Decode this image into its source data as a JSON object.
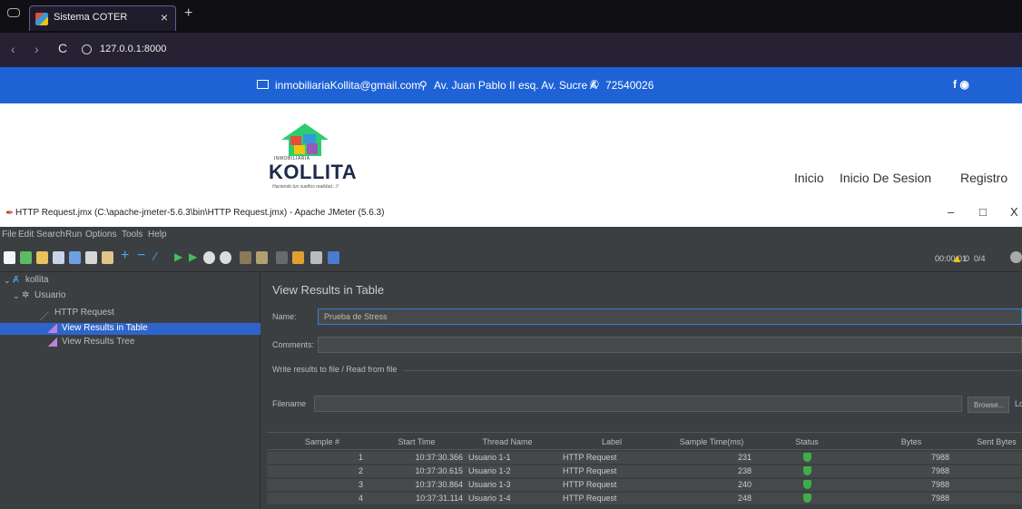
{
  "browser": {
    "tab_title": "Sistema COTER",
    "tab_close": "×",
    "new_tab": "+",
    "url": "127.0.0.1:8000",
    "back": "‹",
    "forward": "›",
    "reload": "C"
  },
  "site": {
    "email": "inmobiliariaKollita@gmail.com",
    "address": "Av. Juan Pablo II esq. Av. Sucre A",
    "phone": "72540026",
    "social": "f  ◉",
    "logo_small": "INMOBILIARIA",
    "logo_brand": "KOLLITA",
    "logo_slogan": "Haciendo tus sueños realidad...!!",
    "nav": [
      "Inicio",
      "Inicio De Sesion",
      "Registro"
    ],
    "colors": {
      "topbar": "#1e62d6"
    }
  },
  "jmeter": {
    "window_title": "HTTP Request.jmx (C:\\apache-jmeter-5.6.3\\bin\\HTTP Request.jmx) - Apache JMeter (5.6.3)",
    "window_controls": [
      "–",
      "□",
      "X"
    ],
    "menu": [
      "File",
      "Edit",
      "Search",
      "Run",
      "Options",
      "Tools",
      "Help"
    ],
    "timer": "00:00:01",
    "warn_count": "0",
    "threads": "0/4",
    "tree": [
      {
        "label": "kollita",
        "icon": "testplan-icon"
      },
      {
        "label": "Usuario",
        "icon": "gear-icon"
      },
      {
        "label": "HTTP Request",
        "icon": "pen-icon"
      },
      {
        "label": "View Results in Table",
        "icon": "chart-icon"
      },
      {
        "label": "View Results Tree",
        "icon": "chart-icon"
      }
    ],
    "panel": {
      "title": "View Results in Table",
      "name_label": "Name:",
      "name_value": "Prueba de Stress",
      "comments_label": "Comments:",
      "comments_value": "",
      "file_legend": "Write results to file / Read from file",
      "filename_label": "Filename",
      "browse_label": "Browse...",
      "log_label": "Lo"
    },
    "table": {
      "columns": [
        "Sample #",
        "Start Time",
        "Thread Name",
        "Label",
        "Sample Time(ms)",
        "Status",
        "Bytes",
        "Sent Bytes"
      ],
      "rows": [
        {
          "sample": "1",
          "start": "10:37:30.366",
          "thread": "Usuario 1-1",
          "label": "HTTP Request",
          "time": "231",
          "bytes": "7988"
        },
        {
          "sample": "2",
          "start": "10:37:30.615",
          "thread": "Usuario 1-2",
          "label": "HTTP Request",
          "time": "238",
          "bytes": "7988"
        },
        {
          "sample": "3",
          "start": "10:37:30.864",
          "thread": "Usuario 1-3",
          "label": "HTTP Request",
          "time": "240",
          "bytes": "7988"
        },
        {
          "sample": "4",
          "start": "10:37:31.114",
          "thread": "Usuario 1-4",
          "label": "HTTP Request",
          "time": "248",
          "bytes": "7988"
        }
      ]
    }
  }
}
